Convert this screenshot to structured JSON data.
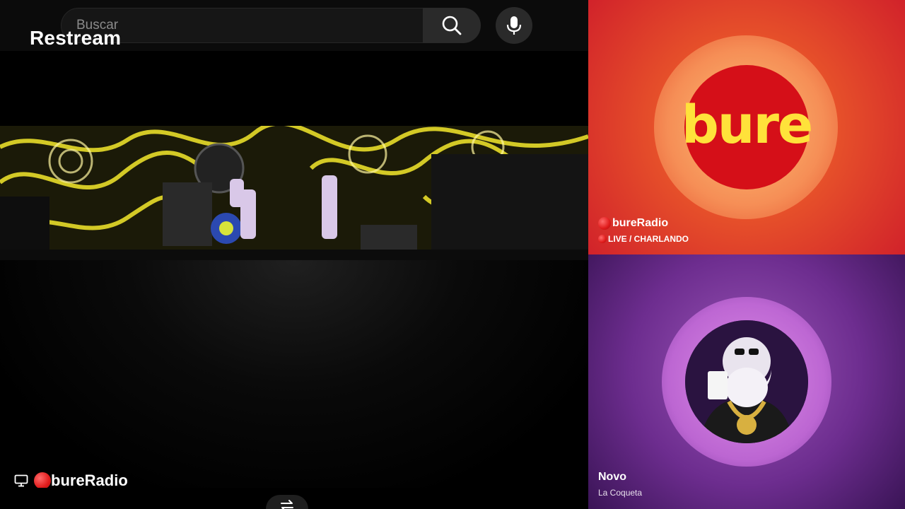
{
  "app": {
    "brand": "Restream"
  },
  "search": {
    "placeholder": "Buscar"
  },
  "icons": {
    "search": "search-icon",
    "mic": "microphone-icon",
    "monitor": "monitor-icon",
    "swap": "swap-icon",
    "live_dot": "red-dot-icon"
  },
  "main_source": {
    "name": "bureRadio"
  },
  "tiles": [
    {
      "logo_text": "bure",
      "name": "bureRadio",
      "subtitle": "LIVE / CHARLANDO"
    },
    {
      "name": "Novo",
      "subtitle": "La Coqueta"
    }
  ],
  "colors": {
    "bure_red": "#d50f18",
    "bure_yellow": "#ffe23a",
    "tile_bottom_purple": "#6d2d8f",
    "live_red": "#e01b1b"
  }
}
